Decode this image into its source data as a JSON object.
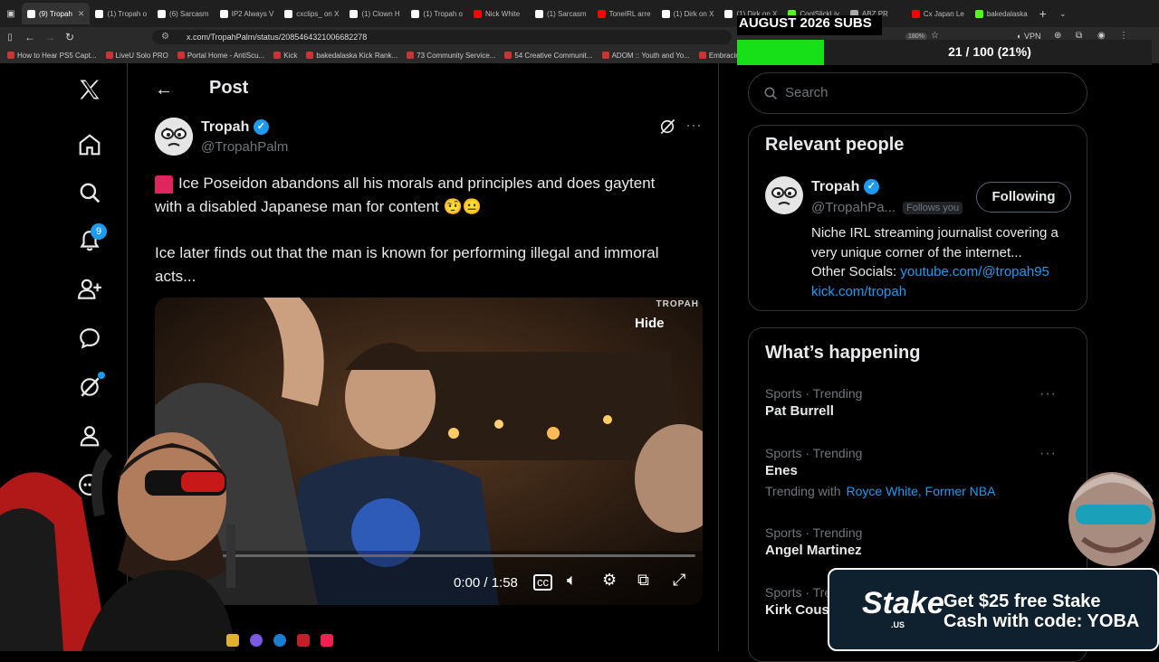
{
  "browser": {
    "tabs": [
      {
        "label": "(9) Tropah",
        "active": true,
        "color": "#ffffff"
      },
      {
        "label": "(1) Tropah o",
        "active": false,
        "color": "#ffffff"
      },
      {
        "label": "(6) Sarcasm",
        "active": false,
        "color": "#ffffff"
      },
      {
        "label": "IP2 Always V",
        "active": false,
        "color": "#ffffff"
      },
      {
        "label": "cxclips_ on X",
        "active": false,
        "color": "#ffffff"
      },
      {
        "label": "(1) Clown H",
        "active": false,
        "color": "#ffffff"
      },
      {
        "label": "(1) Tropah o",
        "active": false,
        "color": "#ffffff"
      },
      {
        "label": "Nick White",
        "active": false,
        "color": "#ff0000"
      },
      {
        "label": "(1) Sarcasm",
        "active": false,
        "color": "#ffffff"
      },
      {
        "label": "ToneIRL arre",
        "active": false,
        "color": "#ff0000"
      },
      {
        "label": "(1) Dirk on X",
        "active": false,
        "color": "#ffffff"
      },
      {
        "label": "(1) Dirk on X",
        "active": false,
        "color": "#ffffff"
      },
      {
        "label": "CoolSlickLiv",
        "active": false,
        "color": "#53fc18"
      },
      {
        "label": "ABZ PR",
        "active": false,
        "color": "#aaaaaa"
      },
      {
        "label": "Cx Japan Le",
        "active": false,
        "color": "#ff0000"
      },
      {
        "label": "bakedalaska",
        "active": false,
        "color": "#53fc18"
      }
    ],
    "url": "x.com/TropahPalm/status/2085464321006682278",
    "zoom": "180%",
    "vpn_label": "VPN",
    "bookmarks": [
      "How to Hear PS5 Capt...",
      "LiveU Solo PRO",
      "Portal Home - AntiScu...",
      "Kick",
      "bakedalaska Kick Rank...",
      "73 Community Service...",
      "54 Creative Communit...",
      "ADOM :: Youth and Yo...",
      "Embracing the Cross a..."
    ]
  },
  "nav": {
    "notifications_badge": "9"
  },
  "post": {
    "header_title": "Post",
    "author_name": "Tropah",
    "author_handle": "@TropahPalm",
    "text_line1": "Ice Poseidon abandons all his morals and principles and does gaytent",
    "text_line2": "with a disabled Japanese man for content 🤨😐",
    "text_line3": "Ice later finds out that the man is known for performing illegal and immoral",
    "text_line4": "acts...",
    "video": {
      "watermark": "TROPAH",
      "hide_label": "Hide",
      "time": "0:00 / 1:58",
      "progress": 0
    }
  },
  "sidebar": {
    "search_placeholder": "Search",
    "relevant": {
      "title": "Relevant people",
      "name": "Tropah",
      "handle": "@TropahPa...",
      "follows_you": "Follows you",
      "following_label": "Following",
      "bio": "Niche IRL streaming journalist covering a very unique corner of the internet...",
      "other_socials_label": "Other Socials:",
      "link1": "youtube.com/@tropah95",
      "link2": "kick.com/tropah"
    },
    "happening": {
      "title": "What’s happening",
      "trends": [
        {
          "meta": "Sports · Trending",
          "title": "Pat Burrell",
          "extra": ""
        },
        {
          "meta": "Sports · Trending",
          "title": "Enes",
          "extra": "Trending with"
        },
        {
          "meta": "Sports · Trending",
          "title": "Angel Martinez",
          "extra": ""
        },
        {
          "meta": "Sports · Tre",
          "title": "Kirk Cous",
          "extra": ""
        }
      ],
      "trending_with_links": "Royce White, Former NBA"
    }
  },
  "overlay": {
    "subs_title": "AUGUST 2026 SUBS",
    "subs_count": "21 / 100 (21%)",
    "subs_progress": 0.21,
    "subs_color": "#18e018",
    "stake_logo": "Stake",
    "stake_logo_sub": ".US",
    "stake_line1": "Get $25 free Stake",
    "stake_line2": "Cash with code: YOBA"
  }
}
